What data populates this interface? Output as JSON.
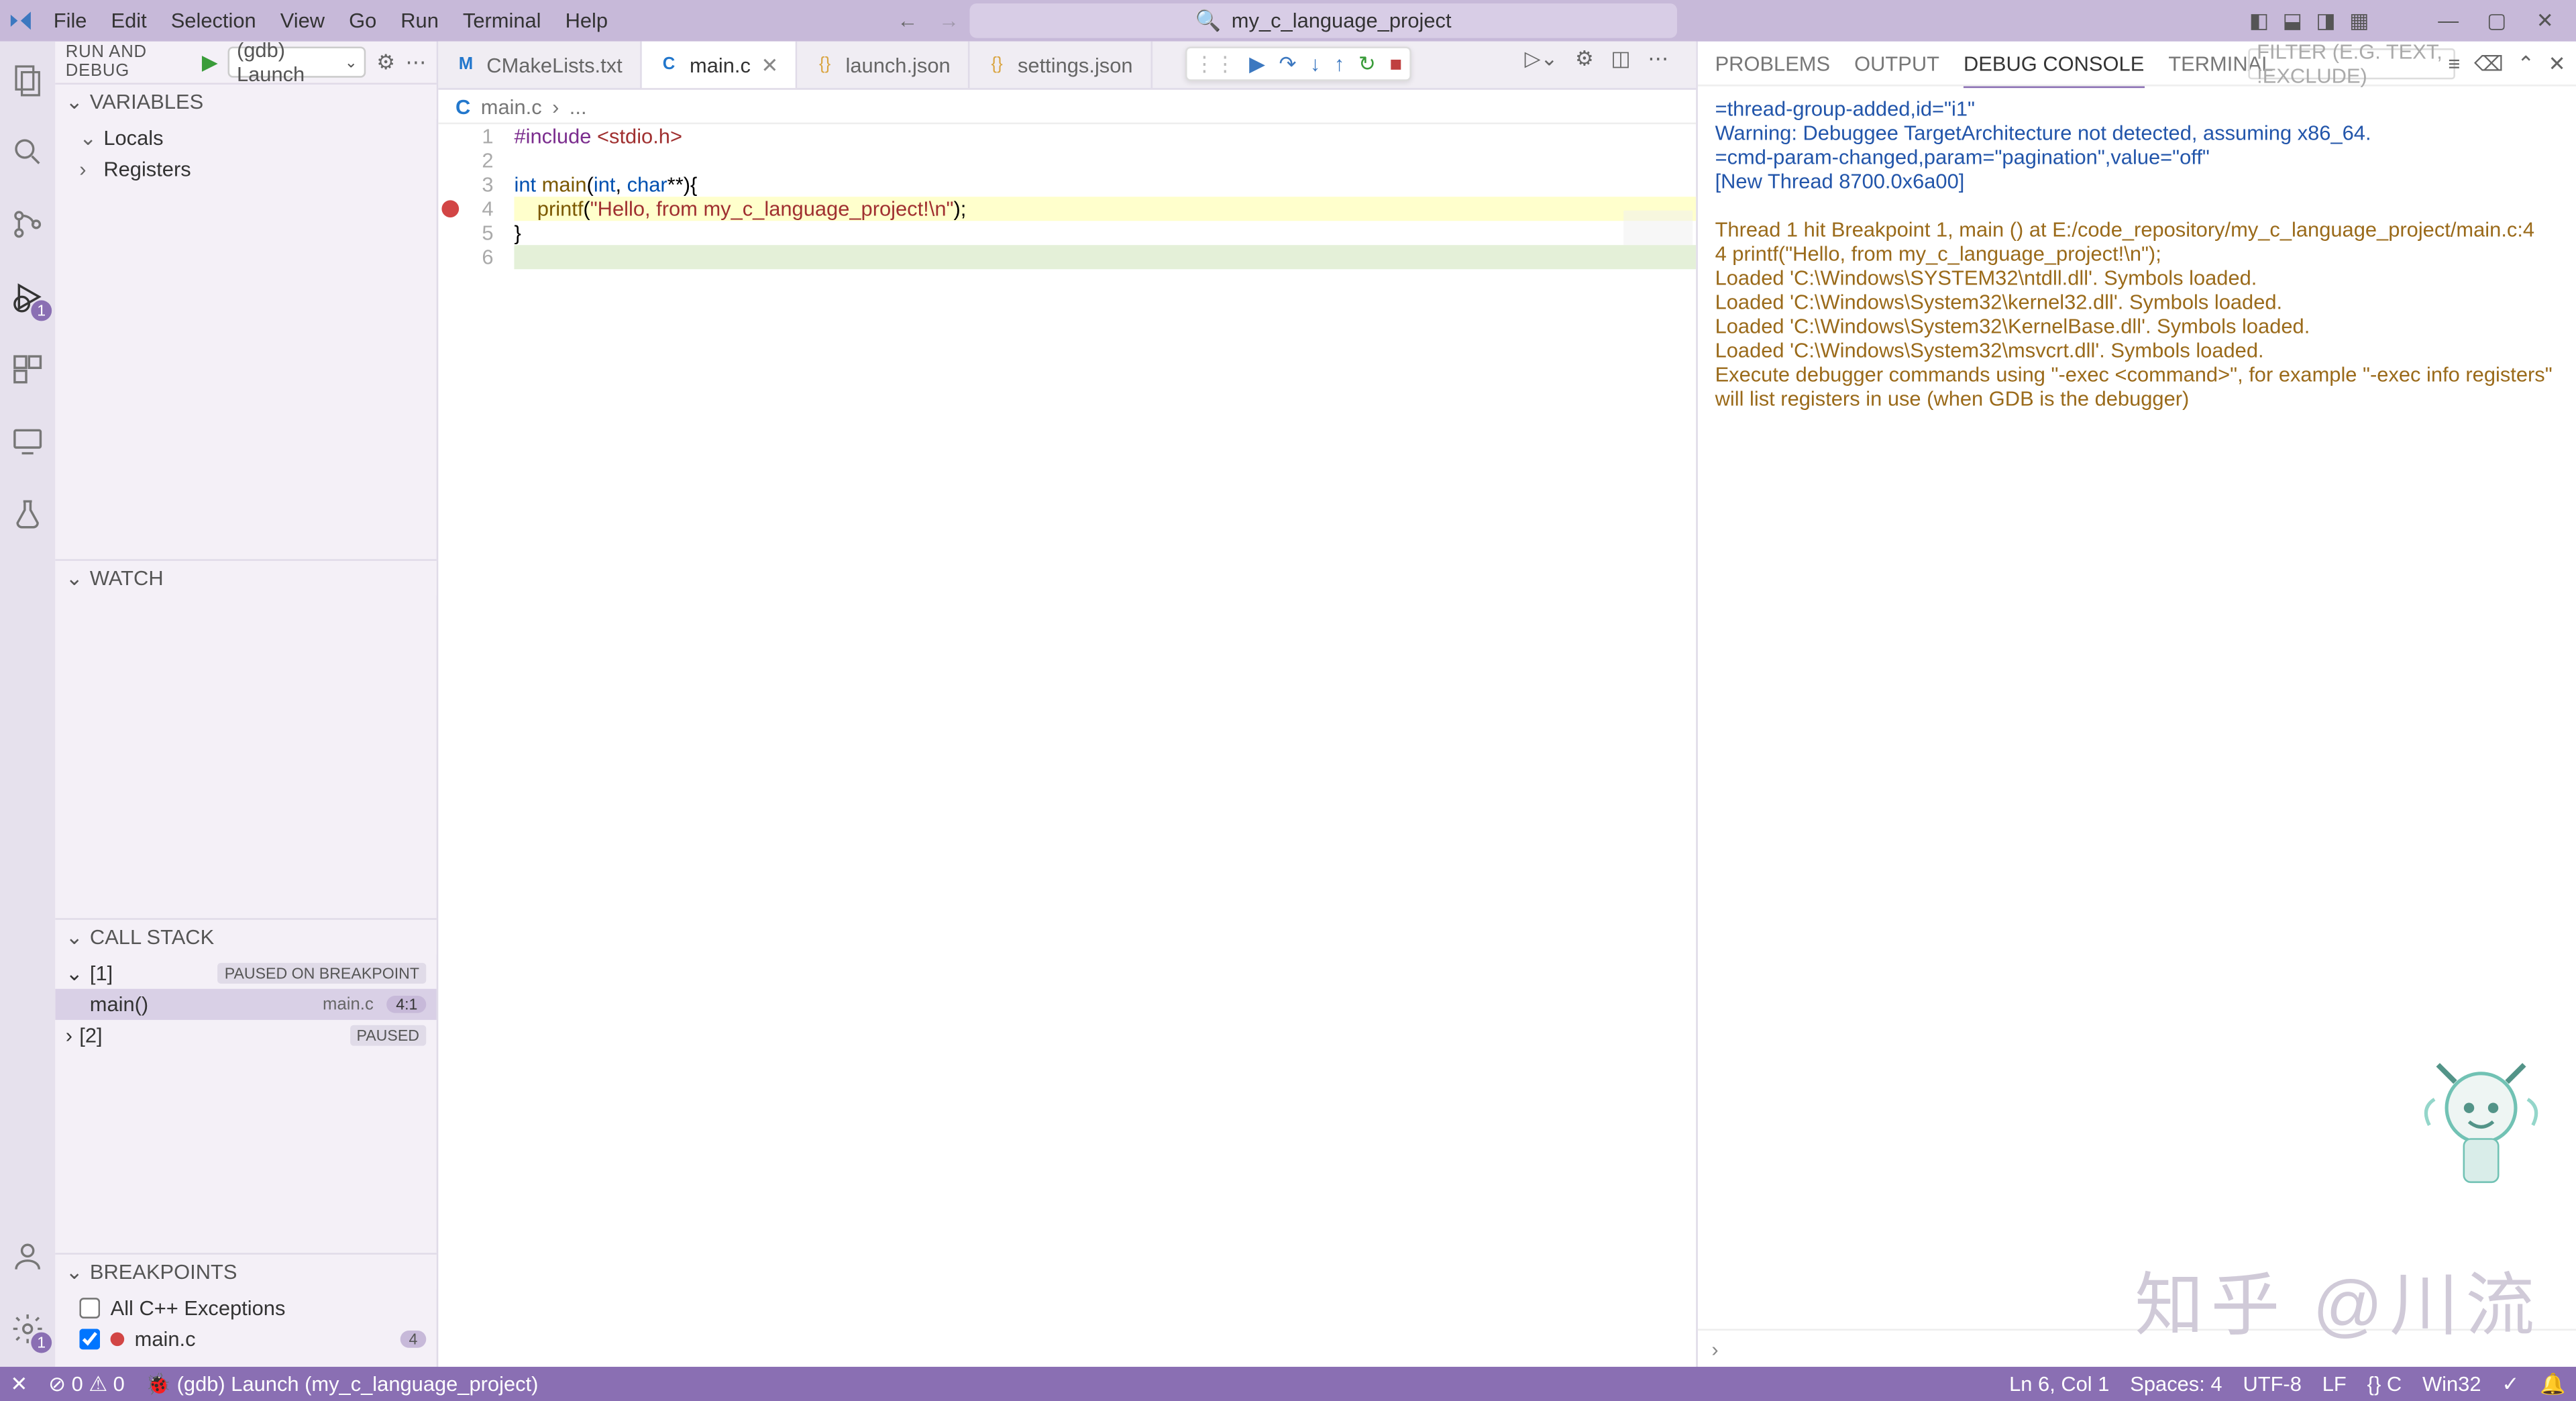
{
  "menu": [
    "File",
    "Edit",
    "Selection",
    "View",
    "Go",
    "Run",
    "Terminal",
    "Help"
  ],
  "search_title": "my_c_language_project",
  "activity": {
    "debug_badge": "1",
    "settings_badge": "1"
  },
  "debug_panel": {
    "title": "RUN AND DEBUG",
    "launch": "(gdb) Launch",
    "sections": {
      "vars": "VARIABLES",
      "watch": "WATCH",
      "callstack": "CALL STACK",
      "bp": "BREAKPOINTS"
    },
    "vars": [
      {
        "name": "Locals"
      },
      {
        "name": "Registers"
      }
    ],
    "callstack": {
      "thread1": {
        "id": "[1]",
        "state": "PAUSED ON BREAKPOINT"
      },
      "frame": {
        "fn": "main()",
        "file": "main.c",
        "line": "4:1"
      },
      "thread2": {
        "id": "[2]",
        "state": "PAUSED"
      }
    },
    "breakpoints": {
      "allcpp": "All C++ Exceptions",
      "file": "main.c",
      "line": "4"
    }
  },
  "tabs": [
    {
      "icon": "cmake",
      "label": "CMakeLists.txt"
    },
    {
      "icon": "c",
      "label": "main.c",
      "active": true,
      "close": true
    },
    {
      "icon": "json",
      "label": "launch.json"
    },
    {
      "icon": "json",
      "label": "settings.json"
    }
  ],
  "breadcrumb": {
    "file": "main.c",
    "sep": "›",
    "rest": "..."
  },
  "code": {
    "lines": [
      "1",
      "2",
      "3",
      "4",
      "5",
      "6"
    ],
    "l1": {
      "a": "#include",
      "b": " <stdio.h>"
    },
    "l3": {
      "a": "int ",
      "b": "main",
      "c": "(",
      "d": "int",
      "e": ", ",
      "f": "char",
      "g": "**){"
    },
    "l4": {
      "a": "    ",
      "b": "printf",
      "c": "(",
      "d": "\"Hello, from my_c_language_project!\\n\"",
      "e": ");"
    },
    "l5": "}",
    "l6": ""
  },
  "console": {
    "tabs": [
      "PROBLEMS",
      "OUTPUT",
      "DEBUG CONSOLE",
      "TERMINAL"
    ],
    "active": 2,
    "filter_placeholder": "Filter (e.g. text, !exclude)",
    "lines": [
      {
        "c": "blue",
        "t": "=thread-group-added,id=\"i1\""
      },
      {
        "c": "blue",
        "t": "Warning: Debuggee TargetArchitecture not detected, assuming x86_64."
      },
      {
        "c": "blue",
        "t": "=cmd-param-changed,param=\"pagination\",value=\"off\""
      },
      {
        "c": "blue",
        "t": "[New Thread 8700.0x6a00]"
      },
      {
        "c": "",
        "t": ""
      },
      {
        "c": "brown",
        "t": "Thread 1 hit Breakpoint 1, main () at E:/code_repository/my_c_language_project/main.c:4"
      },
      {
        "c": "brown",
        "t": "4               printf(\"Hello, from my_c_language_project!\\n\");"
      },
      {
        "c": "brown",
        "t": "Loaded 'C:\\Windows\\SYSTEM32\\ntdll.dll'. Symbols loaded."
      },
      {
        "c": "brown",
        "t": "Loaded 'C:\\Windows\\System32\\kernel32.dll'. Symbols loaded."
      },
      {
        "c": "brown",
        "t": "Loaded 'C:\\Windows\\System32\\KernelBase.dll'. Symbols loaded."
      },
      {
        "c": "brown",
        "t": "Loaded 'C:\\Windows\\System32\\msvcrt.dll'. Symbols loaded."
      },
      {
        "c": "brown",
        "t": "Execute debugger commands using \"-exec <command>\", for example \"-exec info registers\" will list registers in use (when GDB is the debugger)"
      }
    ],
    "repl": "›"
  },
  "watermark": "知乎  @川流",
  "statusbar": {
    "left": [
      "✕",
      "⊘ 0 ⚠ 0",
      "🐞 (gdb) Launch (my_c_language_project)"
    ],
    "right": [
      "Ln 6, Col 1",
      "Spaces: 4",
      "UTF-8",
      "LF",
      "{} C",
      "Win32",
      "✓",
      "🔔"
    ]
  }
}
